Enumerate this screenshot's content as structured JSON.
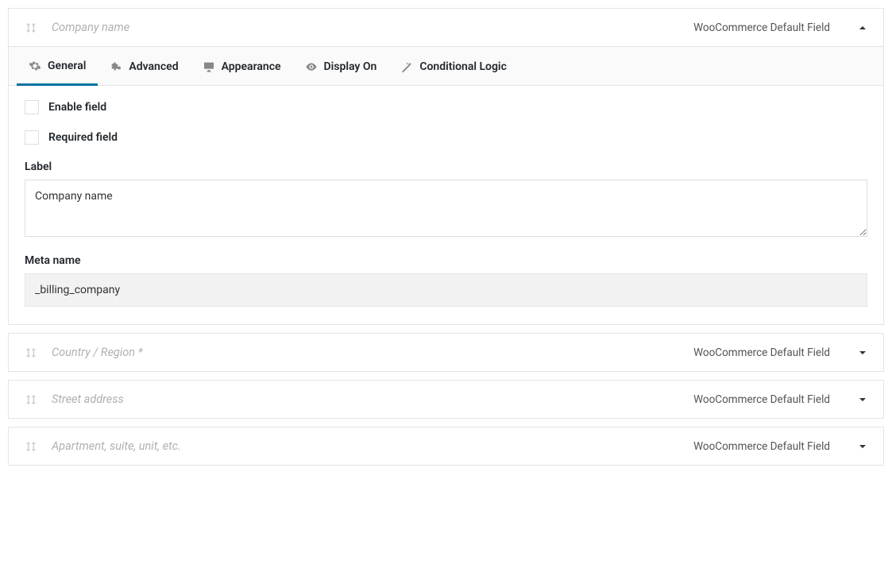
{
  "fields": [
    {
      "title": "Company name",
      "meta": "WooCommerce Default Field",
      "expanded": true
    },
    {
      "title": "Country / Region *",
      "meta": "WooCommerce Default Field",
      "expanded": false
    },
    {
      "title": "Street address",
      "meta": "WooCommerce Default Field",
      "expanded": false
    },
    {
      "title": "Apartment, suite, unit, etc.",
      "meta": "WooCommerce Default Field",
      "expanded": false
    }
  ],
  "tabs": {
    "general": "General",
    "advanced": "Advanced",
    "appearance": "Appearance",
    "displayOn": "Display On",
    "conditional": "Conditional Logic"
  },
  "panel": {
    "enableField": "Enable field",
    "requiredField": "Required field",
    "labelLabel": "Label",
    "labelValue": "Company name",
    "metaNameLabel": "Meta name",
    "metaNameValue": "_billing_company"
  }
}
